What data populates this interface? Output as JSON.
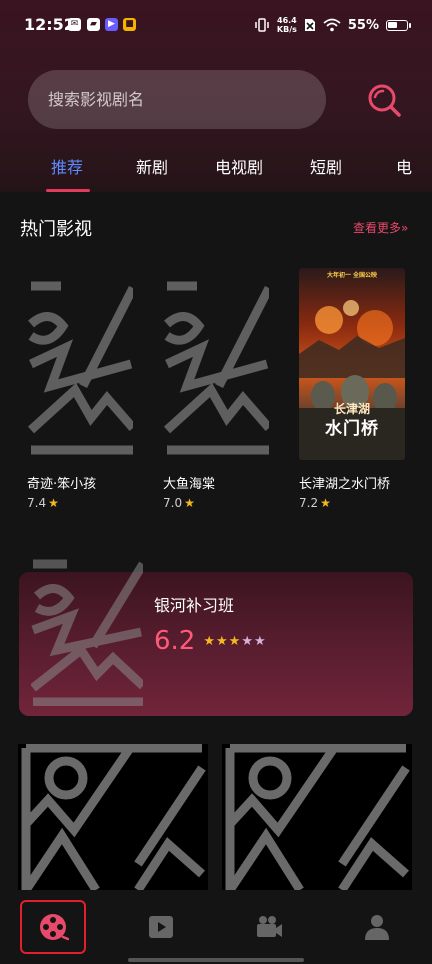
{
  "status_bar": {
    "time": "12:52",
    "net_speed_value": "46.4",
    "net_speed_unit": "KB/s",
    "battery_percent": "55%",
    "battery_level": 0.55
  },
  "search": {
    "placeholder": "搜索影视剧名"
  },
  "tabs": [
    {
      "label": "推荐",
      "active": true
    },
    {
      "label": "新剧",
      "active": false
    },
    {
      "label": "电视剧",
      "active": false
    },
    {
      "label": "短剧",
      "active": false
    },
    {
      "label": "电",
      "active": false
    }
  ],
  "section": {
    "title": "热门影视",
    "more": "查看更多»"
  },
  "cards": [
    {
      "title": "奇迹·笨小孩",
      "rating": "7.4"
    },
    {
      "title": "大鱼海棠",
      "rating": "7.0"
    },
    {
      "title": "长津湖之水门桥",
      "rating": "7.2",
      "poster_title_line1": "长津湖",
      "poster_title_line2": "水门桥",
      "poster_top_text": "大年初一 全国公映"
    }
  ],
  "featured": {
    "title": "银河补习班",
    "score": "6.2",
    "stars_filled": 3,
    "stars_total": 5
  },
  "colors": {
    "accent": "#e13a5a",
    "tab_active": "#5b8bff",
    "score": "#ff5a7a",
    "star": "#f5b820"
  },
  "nav": [
    {
      "icon": "film-reel-icon",
      "active": true
    },
    {
      "icon": "play-icon",
      "active": false
    },
    {
      "icon": "video-camera-icon",
      "active": false
    },
    {
      "icon": "user-icon",
      "active": false
    }
  ]
}
